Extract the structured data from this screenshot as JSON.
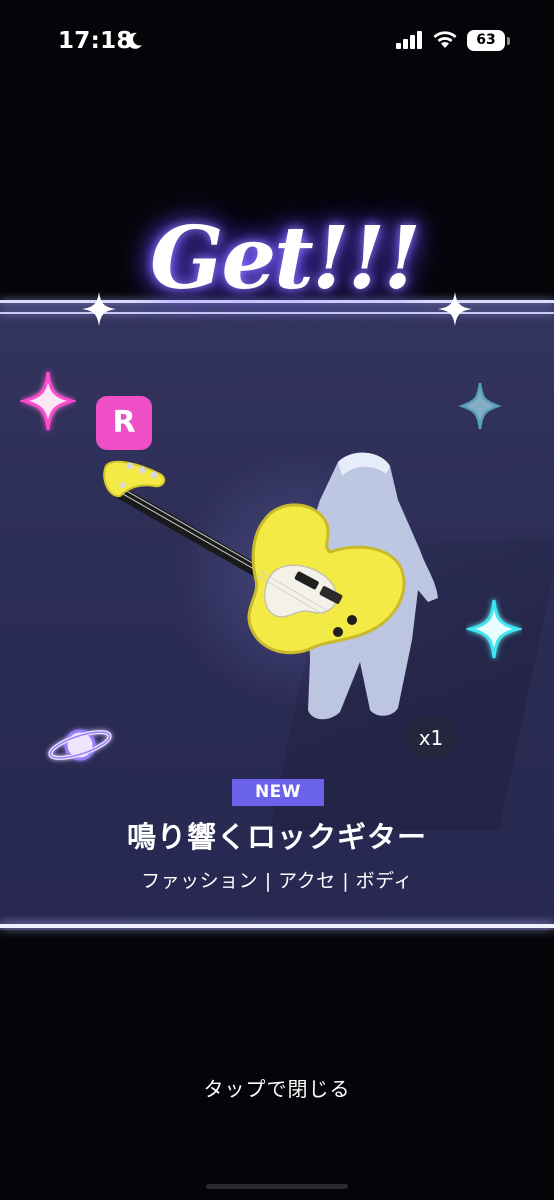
{
  "status_bar": {
    "time": "17:18",
    "battery_level": "63",
    "icons": [
      "moon-icon",
      "cellular-signal-icon",
      "wifi-icon",
      "battery-icon"
    ]
  },
  "reward": {
    "title": "Get!!!",
    "rarity": "R",
    "quantity": "x1",
    "new_tag": "NEW",
    "item_name": "鳴り響くロックギター",
    "item_category": "ファッション | アクセ | ボディ",
    "item_icon": "guitar-icon",
    "colors": {
      "panel": "#2c2d55",
      "rarity_badge": "#ef4fc6",
      "new_tag": "#6a62e8",
      "guitar_body": "#f4ea45"
    }
  },
  "footer": {
    "tap_to_close": "タップで閉じる"
  }
}
